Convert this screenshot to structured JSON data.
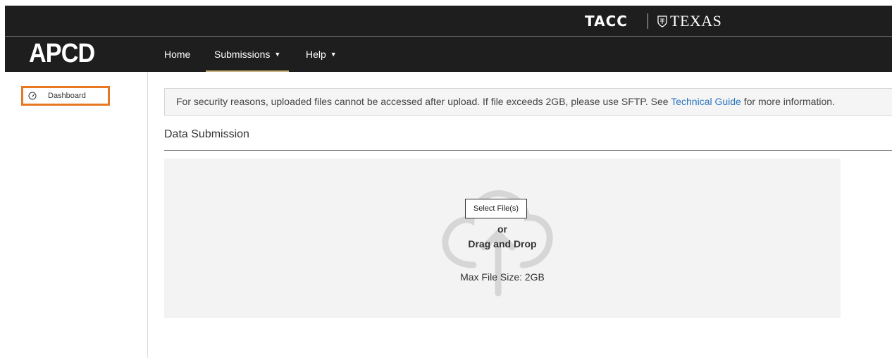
{
  "brand": {
    "tacc": "TACC",
    "texas": "TEXAS"
  },
  "app": {
    "logo": "APCD"
  },
  "nav": {
    "items": [
      {
        "label": "Home"
      },
      {
        "label": "Submissions",
        "active": true
      },
      {
        "label": "Help"
      }
    ]
  },
  "sidebar": {
    "items": [
      {
        "label": "Dashboard",
        "icon": "gauge-icon",
        "highlighted": true
      }
    ]
  },
  "notice": {
    "text_before": "For security reasons, uploaded files cannot be accessed after upload. If file exceeds 2GB, please use SFTP. See ",
    "link": "Technical Guide",
    "text_after": " for more information."
  },
  "section": {
    "title": "Data Submission"
  },
  "upload": {
    "select_label": "Select File(s)",
    "or_label": "or",
    "drag_label": "Drag and Drop",
    "max_size": "Max File Size: 2GB"
  },
  "colors": {
    "header_bg": "#1e1e1e",
    "highlight_border": "#e87722",
    "active_nav_underline": "#c9b37e",
    "link": "#2a74bf"
  }
}
